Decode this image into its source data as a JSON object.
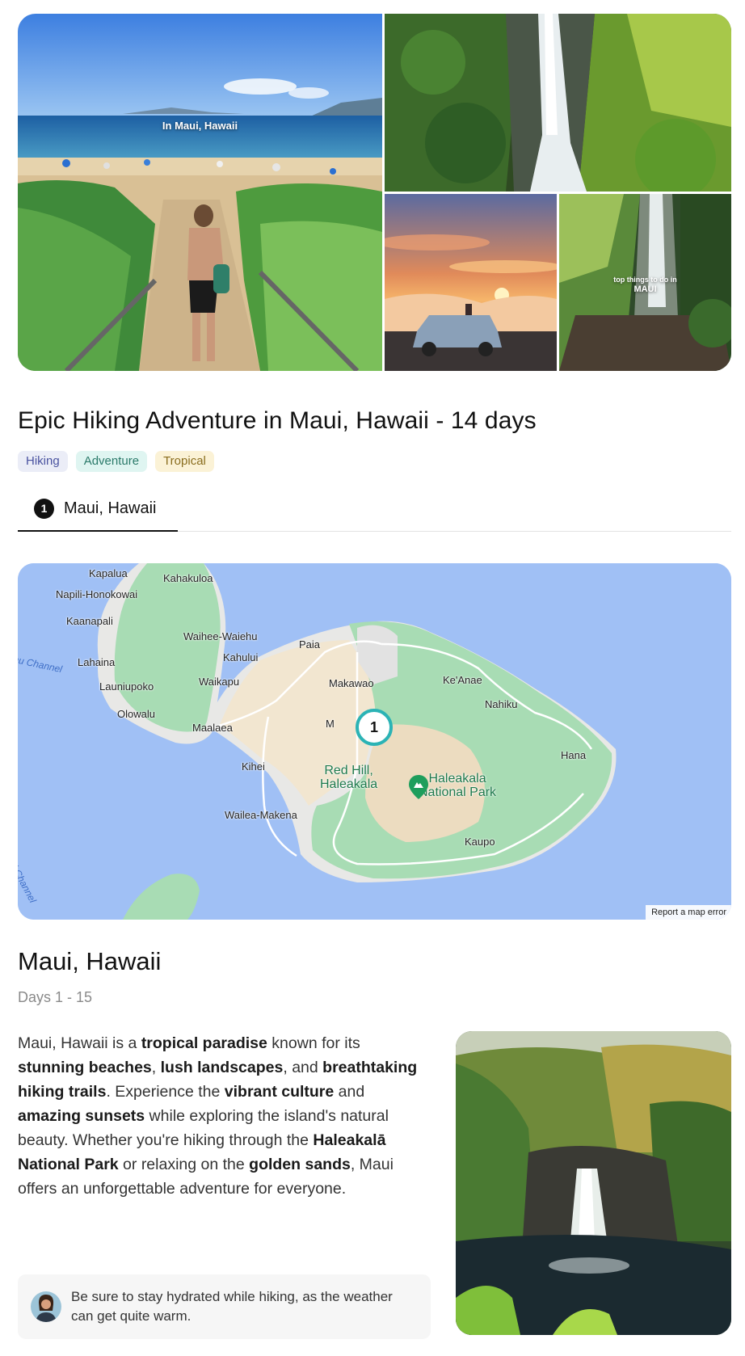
{
  "gallery": {
    "main_caption": "In Maui, Hawaii",
    "waterfall_caption_small": "top things to do in",
    "waterfall_caption_big": "MAUI"
  },
  "trip": {
    "title": "Epic Hiking Adventure in Maui, Hawaii - 14 days",
    "tags": [
      "Hiking",
      "Adventure",
      "Tropical"
    ]
  },
  "tabs": [
    {
      "number": "1",
      "label": "Maui, Hawaii"
    }
  ],
  "map": {
    "places": {
      "kapalua": "Kapalua",
      "kahakuloa": "Kahakuloa",
      "napili": "Napili-Honokowai",
      "kaanapali": "Kaanapali",
      "waihee": "Waihee-Waiehu",
      "paia": "Paia",
      "kahului": "Kahului",
      "lahaina": "Lahaina",
      "launiupoko": "Launiupoko",
      "waikapu": "Waikapu",
      "makawao": "Makawao",
      "keanae": "Ke'Anae",
      "nahiku": "Nahiku",
      "olowalu": "Olowalu",
      "maalaea": "Maalaea",
      "pukalani": "M",
      "hana": "Hana",
      "kihei": "Kihei",
      "wailea": "Wailea-Makena",
      "kaupo": "Kaupo"
    },
    "channels": {
      "auau": "au Channel",
      "alalakeiki": "alaikahiki Channel"
    },
    "parks": {
      "red_hill": "Red Hill,\nHaleakala",
      "haleakala": "Haleakala\nNational Park"
    },
    "marker": "1",
    "report_error": "Report a map error"
  },
  "destination": {
    "title": "Maui, Hawaii",
    "days": "Days 1 - 15",
    "tip": "Be sure to stay hydrated while hiking, as the weather can get quite warm."
  },
  "description": {
    "p1": "Maui, Hawaii is a ",
    "b1": "tropical paradise",
    "p2": " known for its ",
    "b2": "stunning beaches",
    "p3": ", ",
    "b3": "lush landscapes",
    "p4": ", and ",
    "b4": "breathtaking hiking trails",
    "p5": ". Experience the ",
    "b5": "vibrant culture",
    "p6": " and ",
    "b6": "amazing sunsets",
    "p7": " while exploring the island's natural beauty. Whether you're hiking through the ",
    "b7": "Haleakalā National Park",
    "p8": " or relaxing on the ",
    "b8": "golden sands",
    "p9": ", Maui offers an unforgettable adventure for everyone."
  },
  "colors": {
    "accent_teal": "#2bb3b5",
    "ocean": "#a0c0f5",
    "land_green": "#a8dcb4"
  }
}
